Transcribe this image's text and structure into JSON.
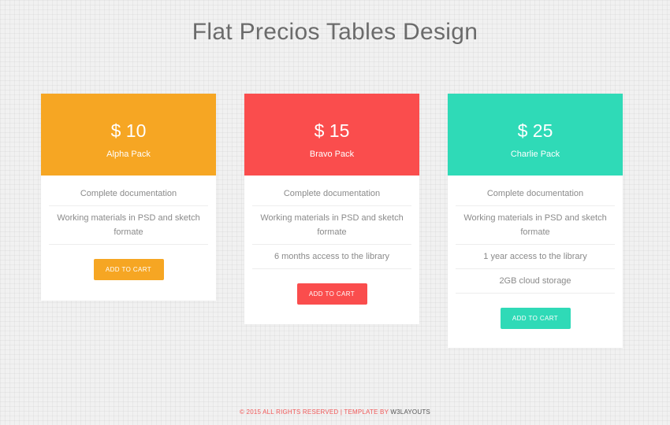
{
  "page": {
    "title": "Flat Precios Tables Design"
  },
  "plans": [
    {
      "price": "$ 10",
      "name": "Alpha Pack",
      "color": "#f6a623",
      "features": [
        "Complete documentation",
        "Working materials in PSD and sketch formate"
      ],
      "button_label": "ADD TO CART"
    },
    {
      "price": "$ 15",
      "name": "Bravo Pack",
      "color": "#fa4d4d",
      "features": [
        "Complete documentation",
        "Working materials in PSD and sketch formate",
        "6 months access to the library"
      ],
      "button_label": "ADD TO CART"
    },
    {
      "price": "$ 25",
      "name": "Charlie Pack",
      "color": "#2fdab7",
      "features": [
        "Complete documentation",
        "Working materials in PSD and sketch formate",
        "1 year access to the library",
        "2GB cloud storage"
      ],
      "button_label": "ADD TO CART"
    }
  ],
  "footer": {
    "text": "© 2015 ALL RIGHTS RESERVED | TEMPLATE BY ",
    "link": "W3LAYOUTS"
  }
}
